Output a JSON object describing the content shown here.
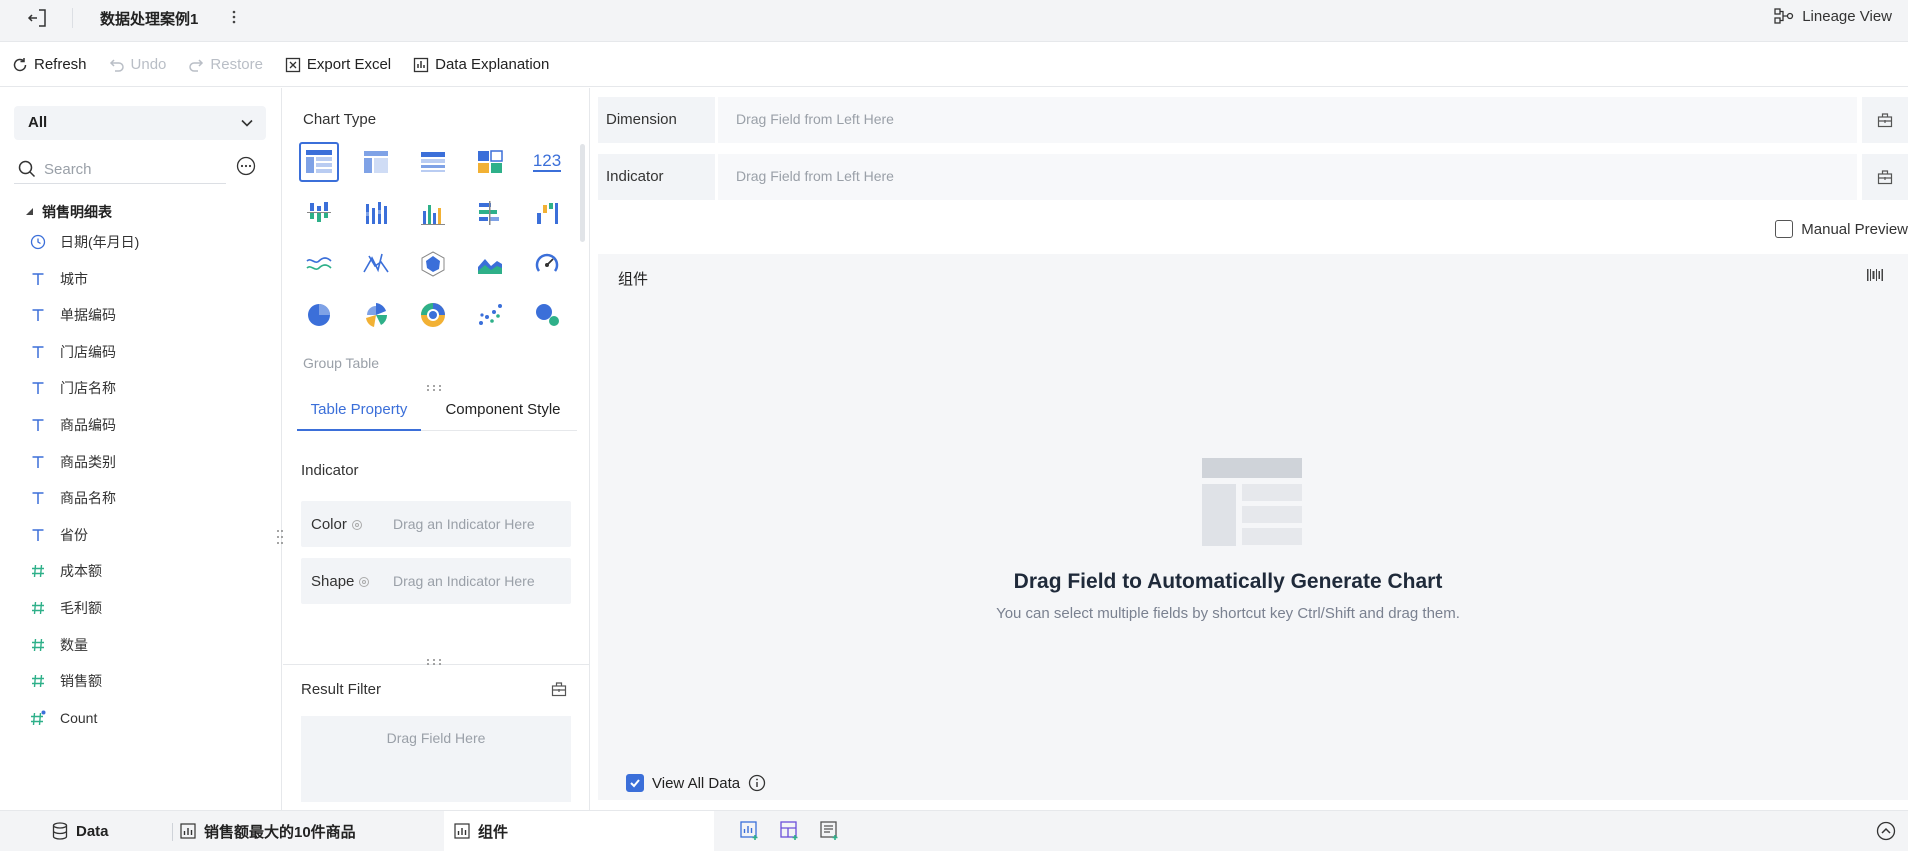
{
  "header": {
    "title": "数据处理案例1",
    "lineage_label": "Lineage View"
  },
  "toolbar": {
    "refresh": "Refresh",
    "undo": "Undo",
    "restore": "Restore",
    "export": "Export Excel",
    "explain": "Data Explanation"
  },
  "left_panel": {
    "selector_value": "All",
    "search_placeholder": "Search",
    "table_name": "销售明细表",
    "fields": [
      {
        "label": "日期(年月日)",
        "type": "date"
      },
      {
        "label": "城市",
        "type": "text"
      },
      {
        "label": "单据编码",
        "type": "text"
      },
      {
        "label": "门店编码",
        "type": "text"
      },
      {
        "label": "门店名称",
        "type": "text"
      },
      {
        "label": "商品编码",
        "type": "text"
      },
      {
        "label": "商品类别",
        "type": "text"
      },
      {
        "label": "商品名称",
        "type": "text"
      },
      {
        "label": "省份",
        "type": "text"
      },
      {
        "label": "成本额",
        "type": "number"
      },
      {
        "label": "毛利额",
        "type": "number"
      },
      {
        "label": "数量",
        "type": "number"
      },
      {
        "label": "销售额",
        "type": "number"
      },
      {
        "label": "Count",
        "type": "number-calc"
      }
    ]
  },
  "middle_panel": {
    "chart_type_label": "Chart Type",
    "selected_chart_name": "Group Table",
    "number_chart_glyph": "123",
    "tabs": [
      "Table Property",
      "Component Style"
    ],
    "indicator_label": "Indicator",
    "color_label": "Color",
    "shape_label": "Shape",
    "indicator_placeholder": "Drag an Indicator Here",
    "result_filter_label": "Result Filter",
    "result_filter_placeholder": "Drag Field Here"
  },
  "right_panel": {
    "dimension_label": "Dimension",
    "indicator_label": "Indicator",
    "drop_placeholder": "Drag Field from Left Here",
    "manual_preview": "Manual Preview",
    "component_title": "组件",
    "empty_title": "Drag Field to Automatically Generate Chart",
    "empty_subtitle": "You can select multiple fields by shortcut key Ctrl/Shift and drag them.",
    "view_all_data": "View All Data"
  },
  "bottom_tabs": {
    "data": "Data",
    "tab1": "销售额最大的10件商品",
    "tab2": "组件"
  },
  "colors": {
    "accent": "#3b6fd9",
    "number_field": "#2eb089"
  }
}
